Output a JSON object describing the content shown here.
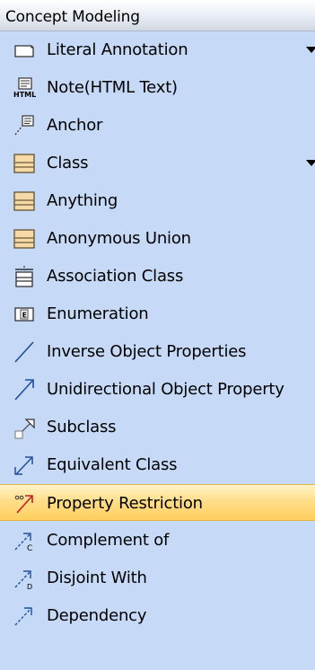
{
  "header": {
    "title": "Concept Modeling"
  },
  "items": [
    {
      "label": "Literal Annotation",
      "icon": "literal-annotation-icon",
      "has_submenu": true
    },
    {
      "label": "Note(HTML Text)",
      "icon": "html-note-icon"
    },
    {
      "label": "Anchor",
      "icon": "anchor-icon"
    },
    {
      "label": "Class",
      "icon": "class-icon",
      "has_submenu": true
    },
    {
      "label": "Anything",
      "icon": "anything-icon"
    },
    {
      "label": "Anonymous Union",
      "icon": "anonymous-union-icon"
    },
    {
      "label": "Association Class",
      "icon": "association-class-icon"
    },
    {
      "label": "Enumeration",
      "icon": "enumeration-icon"
    },
    {
      "label": "Inverse Object Properties",
      "icon": "inverse-object-properties-icon"
    },
    {
      "label": "Unidirectional Object Property",
      "icon": "unidirectional-object-property-icon"
    },
    {
      "label": "Subclass",
      "icon": "subclass-icon"
    },
    {
      "label": "Equivalent Class",
      "icon": "equivalent-class-icon"
    },
    {
      "label": "Property Restriction",
      "icon": "property-restriction-icon",
      "selected": true
    },
    {
      "label": "Complement of",
      "icon": "complement-of-icon"
    },
    {
      "label": "Disjoint With",
      "icon": "disjoint-with-icon"
    },
    {
      "label": "Dependency",
      "icon": "dependency-icon"
    }
  ],
  "icon_letters": {
    "enumeration": "E",
    "html": "HTML",
    "complement": "C",
    "disjoint": "D"
  },
  "colors": {
    "background": "#c6d9f7",
    "selected": "#ffd36b",
    "class_fill": "#f5d9a6",
    "class_stroke": "#6b5a3a",
    "line": "#1f4fa0"
  }
}
